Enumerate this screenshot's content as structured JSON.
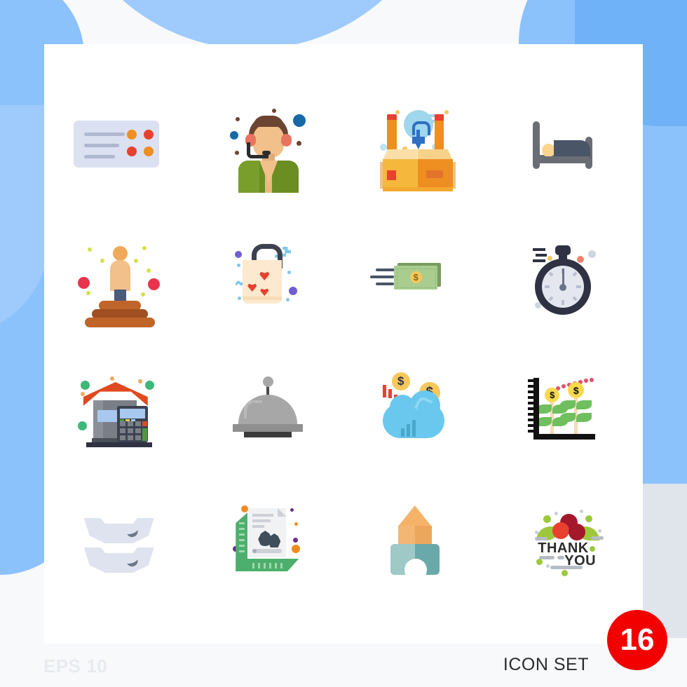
{
  "page": {
    "background_color": "#f7f9fb",
    "card_color": "#ffffff",
    "accent_blue": "#8cc2fb",
    "badge_color": "#f20000"
  },
  "footer": {
    "eps_label": "EPS 10",
    "set_label": "ICON SET",
    "count": "16"
  },
  "grid": {
    "rows": 4,
    "columns": 4,
    "icons": [
      {
        "id": "contact-card",
        "name": "contact card with list lines and dots",
        "row": 1,
        "col": 1
      },
      {
        "id": "support-agent",
        "name": "customer support agent with headset",
        "row": 1,
        "col": 2
      },
      {
        "id": "idea-box",
        "name": "open box with lightbulb ruler pencil",
        "row": 1,
        "col": 3
      },
      {
        "id": "bed",
        "name": "bed with pillow",
        "row": 1,
        "col": 4
      },
      {
        "id": "podium-winner",
        "name": "person standing on podium",
        "row": 2,
        "col": 1
      },
      {
        "id": "gift-bag-hearts",
        "name": "tote bag with hearts",
        "row": 2,
        "col": 2
      },
      {
        "id": "fast-money",
        "name": "flying dollar banknote",
        "row": 2,
        "col": 3
      },
      {
        "id": "stopwatch",
        "name": "stopwatch timer",
        "row": 2,
        "col": 4
      },
      {
        "id": "house-calculator",
        "name": "house with calculator",
        "row": 3,
        "col": 1
      },
      {
        "id": "food-cloche",
        "name": "food serving dome cloche",
        "row": 3,
        "col": 2
      },
      {
        "id": "cloud-money",
        "name": "cloud with dollar coins",
        "row": 3,
        "col": 3
      },
      {
        "id": "money-growth-chart",
        "name": "money plants growth chart",
        "row": 3,
        "col": 4
      },
      {
        "id": "stacked-plates",
        "name": "two stacked plates",
        "row": 4,
        "col": 1
      },
      {
        "id": "document-ruler",
        "name": "image document with ruler",
        "row": 4,
        "col": 2
      },
      {
        "id": "toy-blocks",
        "name": "toy building blocks",
        "row": 4,
        "col": 3
      },
      {
        "id": "thank-you-badge",
        "name": "thank you floral badge",
        "row": 4,
        "col": 4
      }
    ]
  },
  "thank_you": {
    "line1": "THANK",
    "line2": "YOU"
  },
  "currency_symbol": "$"
}
